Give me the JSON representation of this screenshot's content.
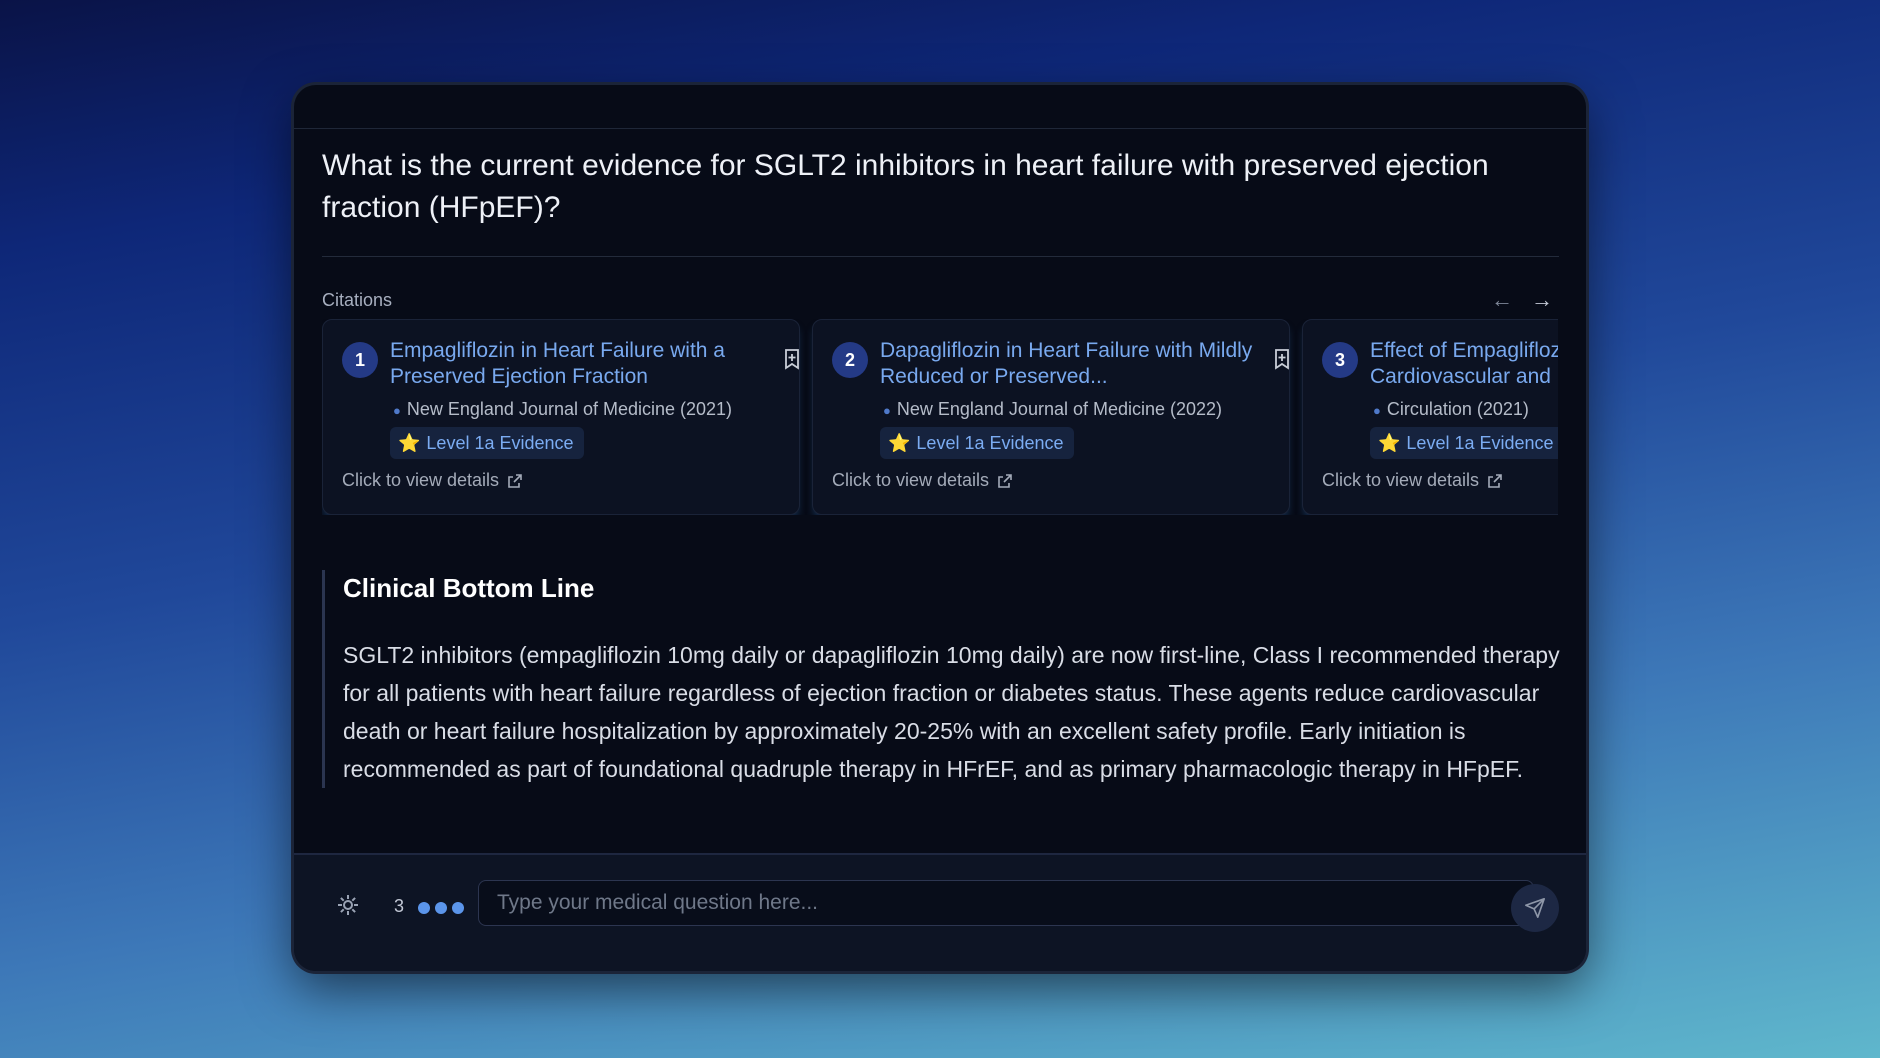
{
  "question": "What is the current evidence for SGLT2 inhibitors in heart failure with preserved ejection fraction (HFpEF)?",
  "citations": {
    "label": "Citations",
    "prev_icon": "arrow-left-icon",
    "next_icon": "arrow-right-icon",
    "items": [
      {
        "num": "1",
        "title": "Empagliflozin in Heart Failure with a Preserved Ejection Fraction",
        "journal": "New England Journal of Medicine (2021)",
        "badge": "Level 1a Evidence",
        "view": "Click to view details"
      },
      {
        "num": "2",
        "title": "Dapagliflozin in Heart Failure with Mildly Reduced or Preserved...",
        "journal": "New England Journal of Medicine (2022)",
        "badge": "Level 1a Evidence",
        "view": "Click to view details"
      },
      {
        "num": "3",
        "title": "Effect of Empagliflozin on Cardiovascular and",
        "journal": "Circulation (2021)",
        "badge": "Level 1a Evidence",
        "view": "Click to view details"
      }
    ]
  },
  "bottom_line": {
    "heading": "Clinical Bottom Line",
    "text": "SGLT2 inhibitors (empagliflozin 10mg daily or dapagliflozin 10mg daily) are now first-line, Class I recommended therapy for all patients with heart failure regardless of ejection fraction or diabetes status. These agents reduce cardiovascular death or heart failure hospitalization by approximately 20-25% with an excellent safety profile. Early initiation is recommended as part of foundational quadruple therapy in HFrEF, and as primary pharmacologic therapy in HFpEF."
  },
  "input_bar": {
    "count": "3",
    "placeholder": "Type your medical question here...",
    "settings_icon": "gear-icon",
    "send_icon": "send-icon"
  },
  "colors": {
    "accent": "#79a9ef",
    "badge_bg": "#16233e",
    "window_bg": "#070b17"
  }
}
